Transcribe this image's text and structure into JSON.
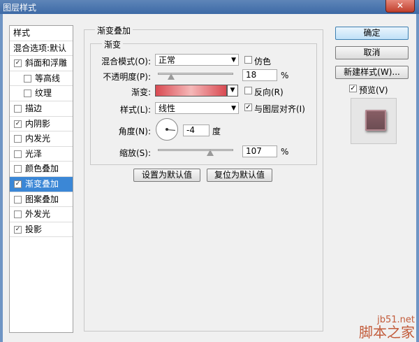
{
  "window": {
    "title": "图层样式",
    "close": "✕"
  },
  "sidebar": {
    "header": "样式",
    "items": [
      {
        "label": "混合选项:默认",
        "checkbox": false,
        "checked": false,
        "indent": 0,
        "selected": false
      },
      {
        "label": "斜面和浮雕",
        "checkbox": true,
        "checked": true,
        "indent": 0,
        "selected": false
      },
      {
        "label": "等高线",
        "checkbox": true,
        "checked": false,
        "indent": 1,
        "selected": false
      },
      {
        "label": "纹理",
        "checkbox": true,
        "checked": false,
        "indent": 1,
        "selected": false
      },
      {
        "label": "描边",
        "checkbox": true,
        "checked": false,
        "indent": 0,
        "selected": false
      },
      {
        "label": "内阴影",
        "checkbox": true,
        "checked": true,
        "indent": 0,
        "selected": false
      },
      {
        "label": "内发光",
        "checkbox": true,
        "checked": false,
        "indent": 0,
        "selected": false
      },
      {
        "label": "光泽",
        "checkbox": true,
        "checked": false,
        "indent": 0,
        "selected": false
      },
      {
        "label": "颜色叠加",
        "checkbox": true,
        "checked": false,
        "indent": 0,
        "selected": false
      },
      {
        "label": "渐变叠加",
        "checkbox": true,
        "checked": true,
        "indent": 0,
        "selected": true
      },
      {
        "label": "图案叠加",
        "checkbox": true,
        "checked": false,
        "indent": 0,
        "selected": false
      },
      {
        "label": "外发光",
        "checkbox": true,
        "checked": false,
        "indent": 0,
        "selected": false
      },
      {
        "label": "投影",
        "checkbox": true,
        "checked": true,
        "indent": 0,
        "selected": false
      }
    ]
  },
  "panel": {
    "group_title": "渐变叠加",
    "subgroup_title": "渐变",
    "blend_mode_label": "混合模式(O):",
    "blend_mode_value": "正常",
    "dither_label": "仿色",
    "opacity_label": "不透明度(P):",
    "opacity_value": "18",
    "opacity_unit": "%",
    "opacity_level": 18,
    "gradient_label": "渐变:",
    "reverse_label": "反向(R)",
    "style_label": "样式(L):",
    "style_value": "线性",
    "align_label": "与图层对齐(I)",
    "angle_label": "角度(N):",
    "angle_value": "-4",
    "angle_unit": "度",
    "scale_label": "缩放(S):",
    "scale_value": "107",
    "scale_unit": "%",
    "scale_level": 107,
    "make_default": "设置为默认值",
    "reset_default": "复位为默认值"
  },
  "actions": {
    "ok": "确定",
    "cancel": "取消",
    "new_style": "新建样式(W)...",
    "preview_label": "预览(V)"
  },
  "watermark": {
    "site": "jb51.net",
    "name": "脚本之家"
  },
  "colors": {
    "selection": "#3b87d6",
    "gradient_edge": "#d94a52",
    "gradient_mid": "#f5b8b8"
  }
}
